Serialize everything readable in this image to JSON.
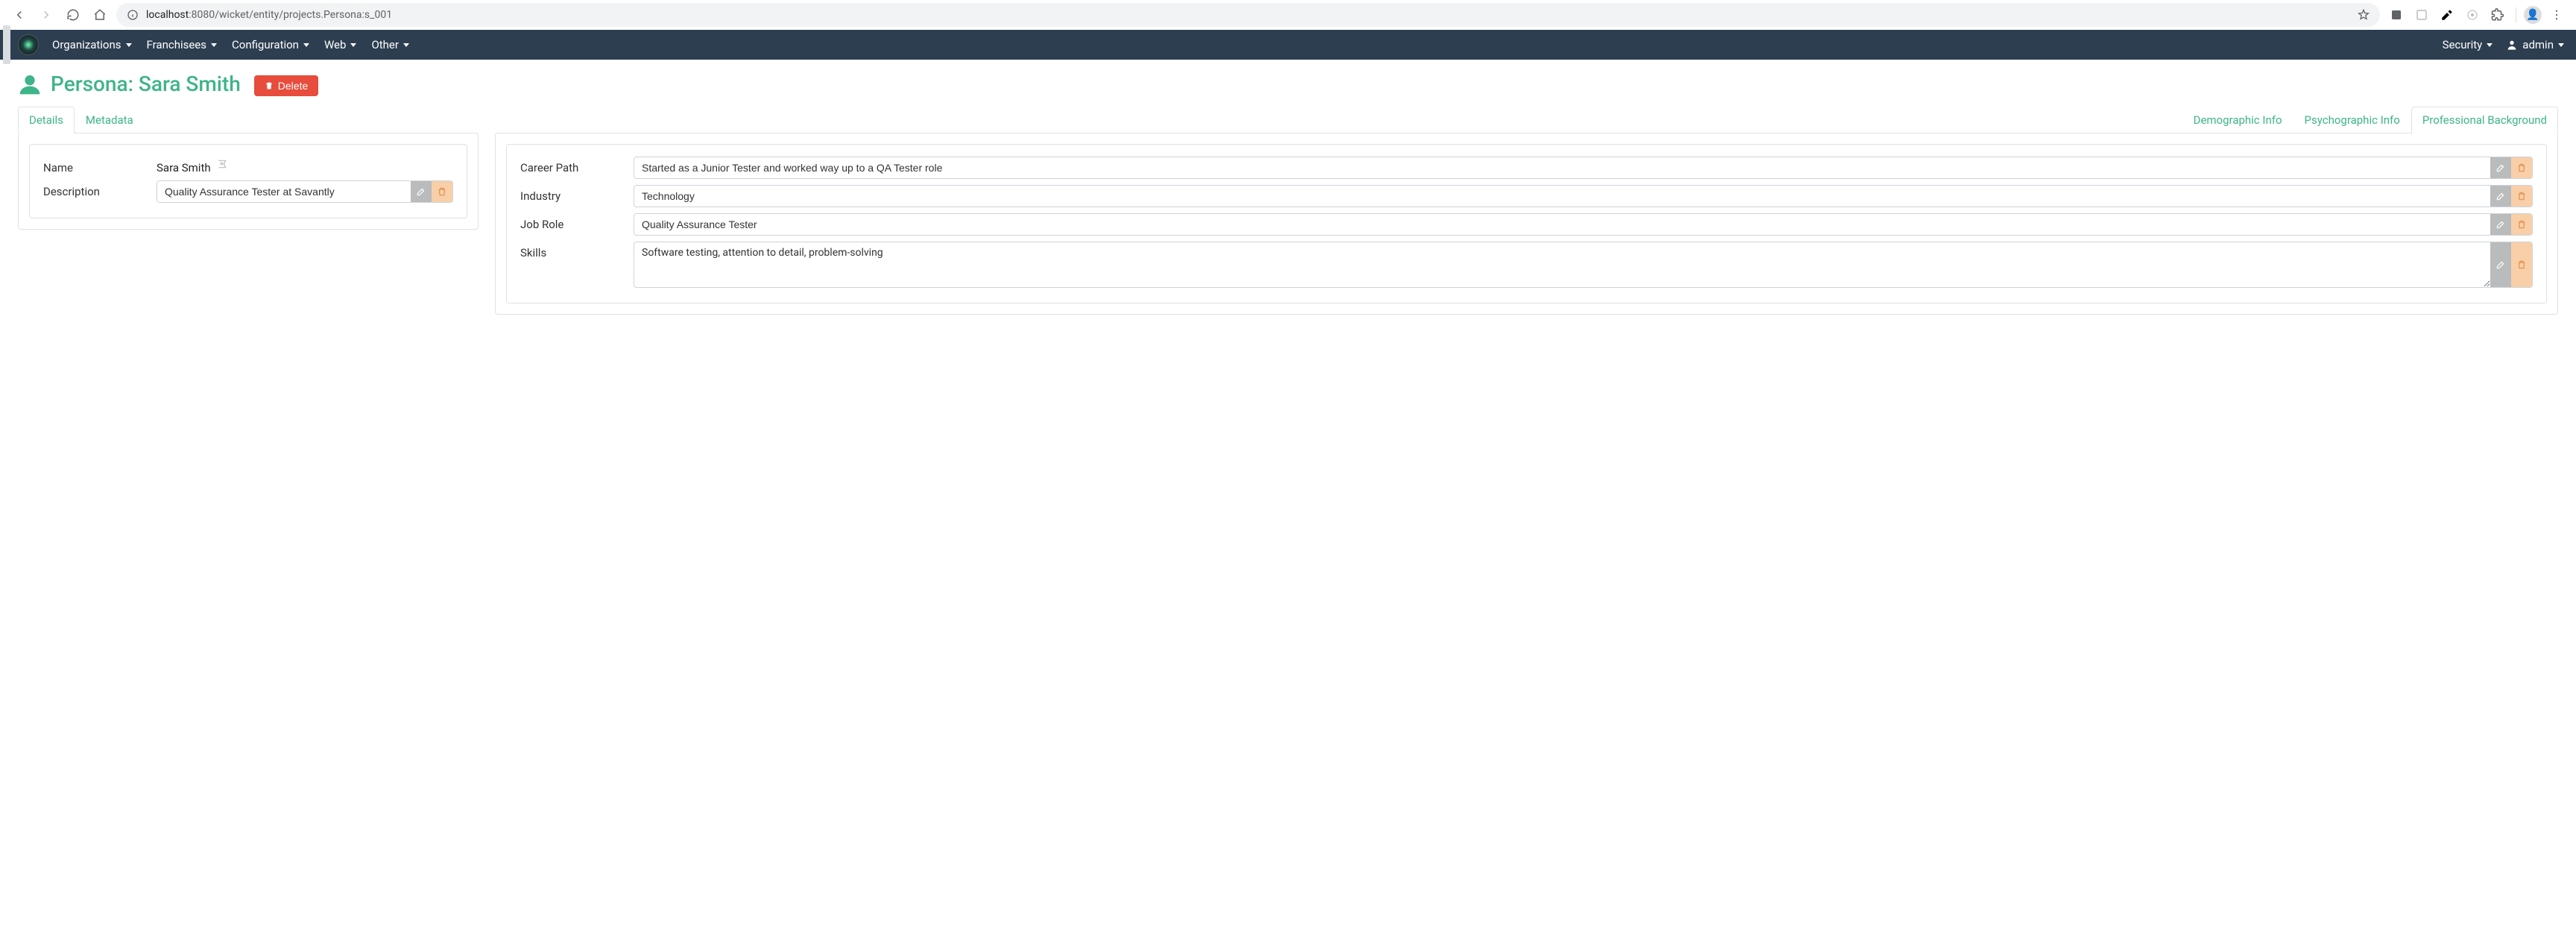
{
  "browser": {
    "url_host": "localhost",
    "url_path": ":8080/wicket/entity/projects.Persona:s_001"
  },
  "navbar": {
    "items": [
      "Organizations",
      "Franchisees",
      "Configuration",
      "Web",
      "Other"
    ],
    "security_label": "Security",
    "user_label": "admin"
  },
  "page": {
    "title": "Persona: Sara Smith",
    "delete_label": "Delete"
  },
  "left_tabs": [
    {
      "label": "Details",
      "active": true
    },
    {
      "label": "Metadata",
      "active": false
    }
  ],
  "right_tabs": [
    {
      "label": "Demographic Info",
      "active": false
    },
    {
      "label": "Psychographic Info",
      "active": false
    },
    {
      "label": "Professional Background",
      "active": true
    }
  ],
  "details": {
    "name_label": "Name",
    "name_value": "Sara Smith",
    "description_label": "Description",
    "description_value": "Quality Assurance Tester at Savantly"
  },
  "prof_bg": {
    "career_path_label": "Career Path",
    "career_path_value": "Started as a Junior Tester and worked way up to a QA Tester role",
    "industry_label": "Industry",
    "industry_value": "Technology",
    "job_role_label": "Job Role",
    "job_role_value": "Quality Assurance Tester",
    "skills_label": "Skills",
    "skills_value": "Software testing, attention to detail, problem-solving"
  }
}
